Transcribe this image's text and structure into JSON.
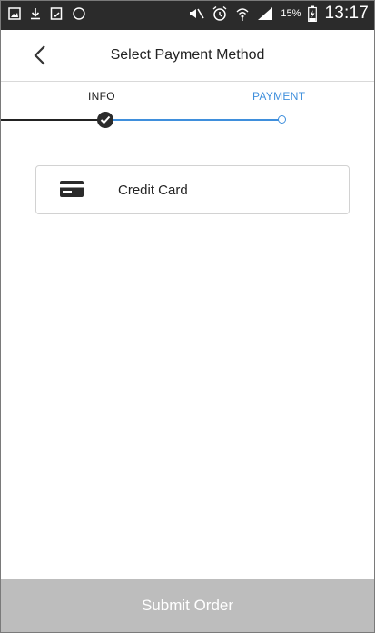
{
  "status_bar": {
    "battery_percent": "15%",
    "time": "13:17"
  },
  "header": {
    "title": "Select Payment Method"
  },
  "stepper": {
    "steps": [
      {
        "label": "INFO",
        "state": "completed"
      },
      {
        "label": "PAYMENT",
        "state": "current"
      }
    ],
    "accent_color": "#3f8fdc"
  },
  "payment_options": [
    {
      "label": "Credit Card",
      "icon": "credit-card-icon"
    }
  ],
  "footer": {
    "submit_label": "Submit Order",
    "submit_state": "disabled"
  },
  "colors": {
    "status_bar_bg": "#2b2b2b",
    "accent": "#3f8fdc",
    "submit_disabled_bg": "#bdbdbd"
  }
}
